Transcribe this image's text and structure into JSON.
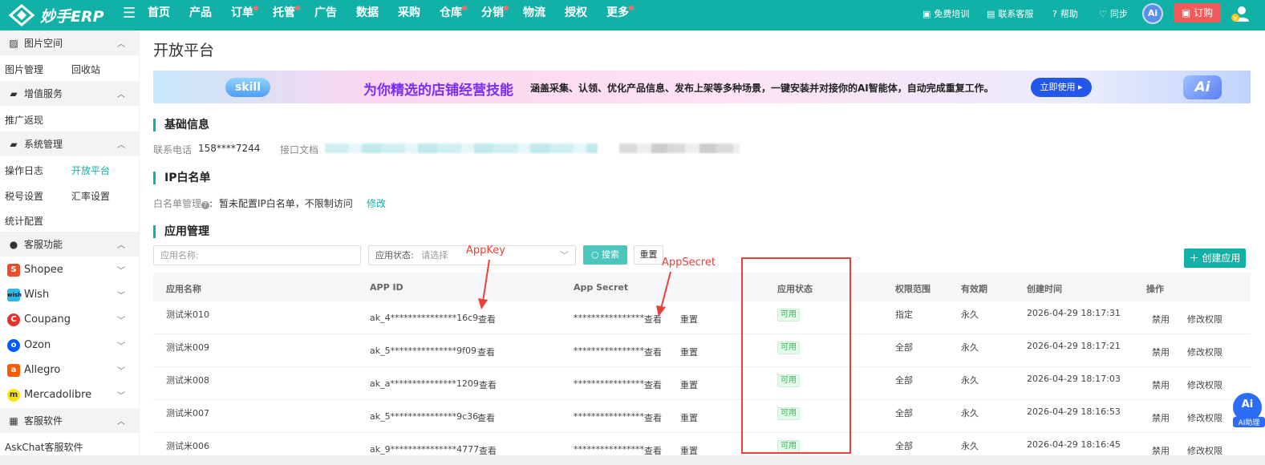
{
  "topbar": {
    "logo_text": "妙手ERP",
    "nav": [
      {
        "label": "首页",
        "dot": false
      },
      {
        "label": "产品",
        "dot": false
      },
      {
        "label": "订单",
        "dot": true
      },
      {
        "label": "托管",
        "dot": true
      },
      {
        "label": "广告",
        "dot": false
      },
      {
        "label": "数据",
        "dot": false
      },
      {
        "label": "采购",
        "dot": false
      },
      {
        "label": "仓库",
        "dot": true
      },
      {
        "label": "分销",
        "dot": true
      },
      {
        "label": "物流",
        "dot": false
      },
      {
        "label": "授权",
        "dot": false
      },
      {
        "label": "更多",
        "dot": true
      }
    ],
    "right": {
      "training": "免费培训",
      "service": "联系客服",
      "help": "帮助",
      "sync": "同步",
      "ai": "Ai",
      "order": "订购"
    }
  },
  "sidebar": {
    "groups": [
      {
        "label": "图片空间",
        "icon": "image-icon",
        "items": [
          "图片管理",
          "回收站"
        ]
      },
      {
        "label": "增值服务",
        "icon": "wallet-icon",
        "items": [
          "推广返现"
        ]
      },
      {
        "label": "系统管理",
        "icon": "wallet-icon",
        "items": [
          "操作日志",
          "开放平台",
          "税号设置",
          "汇率设置",
          "统计配置"
        ]
      },
      {
        "label": "客服功能",
        "icon": "person-icon"
      },
      {
        "label": "客服软件",
        "icon": "grid-icon",
        "items": [
          "AskChat客服软件"
        ]
      }
    ],
    "platforms": [
      "Shopee",
      "Wish",
      "Coupang",
      "Ozon",
      "Allegro",
      "Mercadolibre"
    ],
    "active_item": "开放平台"
  },
  "page": {
    "title": "开放平台",
    "banner": {
      "badge": "skill",
      "title": "为你精选的店铺经营技能",
      "desc": "涵盖采集、认领、优化产品信息、发布上架等多种场景，一键安装并对接你的AI智能体，自动完成重复工作。",
      "button": "立即使用 ▸",
      "ai": "Ai"
    },
    "basic": {
      "title": "基础信息",
      "phone_label": "联系电话",
      "phone_value": "158****7244",
      "doc_label": "接口文档"
    },
    "ip": {
      "title": "IP白名单",
      "label": "白名单管理",
      "value": "暂未配置IP白名单，不限制访问",
      "edit": "修改"
    },
    "apps": {
      "title": "应用管理",
      "name_placeholder": "应用名称:",
      "status_label": "应用状态:",
      "status_placeholder": "请选择",
      "search": "搜索",
      "reset": "重置",
      "create": "创建应用",
      "columns": [
        "应用名称",
        "APP ID",
        "App Secret",
        "应用状态",
        "权限范围",
        "有效期",
        "创建时间",
        "操作"
      ],
      "rows": [
        {
          "name": "测试米010",
          "app_id": "ak_4***************16c9",
          "secret": "****************",
          "status": "可用",
          "scope": "指定",
          "validity": "永久",
          "created": "2026-04-29 18:17:31"
        },
        {
          "name": "测试米009",
          "app_id": "ak_5***************9f09",
          "secret": "****************",
          "status": "可用",
          "scope": "全部",
          "validity": "永久",
          "created": "2026-04-29 18:17:21"
        },
        {
          "name": "测试米008",
          "app_id": "ak_a***************1209",
          "secret": "****************",
          "status": "可用",
          "scope": "全部",
          "validity": "永久",
          "created": "2026-04-29 18:17:03"
        },
        {
          "name": "测试米007",
          "app_id": "ak_5***************9c36",
          "secret": "****************",
          "status": "可用",
          "scope": "全部",
          "validity": "永久",
          "created": "2026-04-29 18:16:53"
        },
        {
          "name": "测试米006",
          "app_id": "ak_9***************4777",
          "secret": "****************",
          "status": "可用",
          "scope": "全部",
          "validity": "永久",
          "created": "2026-04-29 18:16:45"
        }
      ],
      "view": "查看",
      "reset_secret": "重置",
      "disable": "禁用",
      "modify": "修改权限"
    }
  },
  "annotations": {
    "appkey": "AppKey",
    "appsecret": "AppSecret"
  },
  "ai_assistant": "AI助理",
  "colors": {
    "brand": "#12b1a7",
    "annotation": "#e8413a",
    "status_ok": "#3bb35a"
  }
}
